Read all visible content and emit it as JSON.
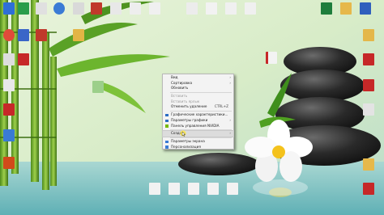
{
  "desktop": {
    "icons": [
      {
        "name": "desktop-icon-1",
        "label": "",
        "color": "#2f6fd6"
      },
      {
        "name": "desktop-icon-2",
        "label": "",
        "color": "#2a9d4a"
      },
      {
        "name": "desktop-icon-3",
        "label": "",
        "color": "#e0e0e0"
      },
      {
        "name": "desktop-icon-4",
        "label": "",
        "color": "#3a7bd5"
      },
      {
        "name": "desktop-icon-5",
        "label": "",
        "color": "#d9d9d9"
      },
      {
        "name": "desktop-icon-6",
        "label": "",
        "color": "#c0392b"
      },
      {
        "name": "desktop-icon-7",
        "label": "",
        "color": "#e8e8e8"
      },
      {
        "name": "desktop-icon-8",
        "label": "",
        "color": "#eeeeee"
      },
      {
        "name": "desktop-icon-9",
        "label": "",
        "color": "#f0f0f0"
      },
      {
        "name": "desktop-icon-10",
        "label": "",
        "color": "#ececec"
      },
      {
        "name": "desktop-icon-11",
        "label": "",
        "color": "#f2f2f2"
      },
      {
        "name": "desktop-icon-12",
        "label": "",
        "color": "#f0f0f0"
      },
      {
        "name": "desktop-icon-13",
        "label": "",
        "color": "#1e7d3c"
      },
      {
        "name": "desktop-icon-14",
        "label": "",
        "color": "#e6b84a"
      },
      {
        "name": "desktop-icon-15",
        "label": "",
        "color": "#2f5fbd"
      },
      {
        "name": "desktop-icon-16",
        "label": "",
        "color": "#e4e4e4"
      },
      {
        "name": "desktop-icon-17",
        "label": "",
        "color": "#efefef"
      },
      {
        "name": "desktop-icon-18",
        "label": "",
        "color": "#f3f3f3"
      },
      {
        "name": "desktop-icon-19",
        "label": "",
        "color": "#f0f0f0"
      },
      {
        "name": "desktop-icon-20",
        "label": "",
        "color": "#eeeeee"
      },
      {
        "name": "desktop-icon-21",
        "label": "",
        "color": "#c62828"
      }
    ]
  },
  "context_menu": {
    "items": [
      {
        "label": "Вид",
        "arrow": "›",
        "disabled": false
      },
      {
        "label": "Сортировка",
        "arrow": "›",
        "disabled": false
      },
      {
        "label": "Обновить",
        "arrow": "",
        "disabled": false
      },
      {
        "sep": true
      },
      {
        "label": "Вставить",
        "arrow": "",
        "disabled": true
      },
      {
        "label": "Вставить ярлык",
        "arrow": "",
        "disabled": true
      },
      {
        "label": "Отменить удаление",
        "shortcut": "CTRL+Z",
        "disabled": false
      },
      {
        "sep": true
      },
      {
        "label": "Графические характеристики...",
        "icon": "intel-graphics-icon",
        "iconColor": "#2b6cc4",
        "disabled": false
      },
      {
        "label": "Параметры графики",
        "icon": "intel-graphics-icon",
        "iconColor": "#2b6cc4",
        "arrow": "›",
        "disabled": false
      },
      {
        "label": "Панель управления NVIDIA",
        "icon": "nvidia-icon",
        "iconColor": "#76b900",
        "disabled": false
      },
      {
        "sep": true
      },
      {
        "label": "Создать",
        "arrow": "›",
        "disabled": false,
        "hover": true
      },
      {
        "sep": true
      },
      {
        "label": "Параметры экрана",
        "icon": "display-settings-icon",
        "iconColor": "#3a7bd5",
        "disabled": false
      },
      {
        "label": "Персонализация",
        "icon": "personalization-icon",
        "iconColor": "#3a7bd5",
        "disabled": false
      }
    ]
  }
}
